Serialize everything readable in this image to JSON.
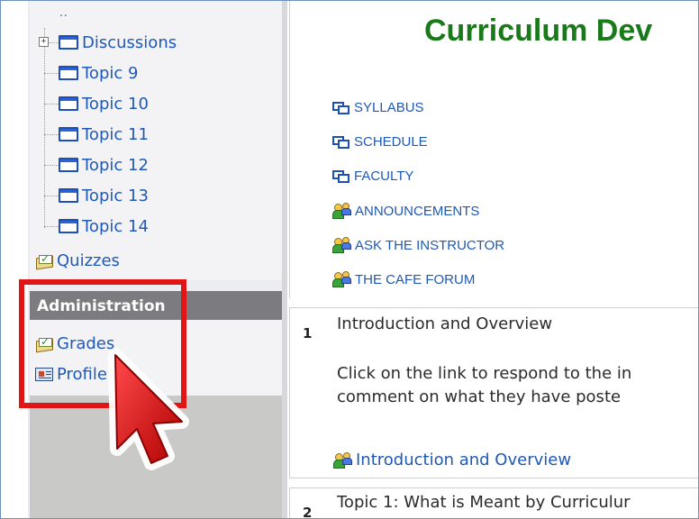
{
  "sidebar": {
    "parent_link": "..",
    "tree_items": [
      {
        "label": "Discussions",
        "expandable": true
      },
      {
        "label": "Topic 9"
      },
      {
        "label": "Topic 10"
      },
      {
        "label": "Topic 11"
      },
      {
        "label": "Topic 12"
      },
      {
        "label": "Topic 13"
      },
      {
        "label": "Topic 14"
      }
    ],
    "quizzes_label": "Quizzes",
    "administration": {
      "title": "Administration",
      "grades_label": "Grades",
      "profile_label": "Profile"
    }
  },
  "main": {
    "title": "Curriculum Dev",
    "resources": [
      {
        "label": "SYLLABUS",
        "icon": "window-icon"
      },
      {
        "label": "SCHEDULE",
        "icon": "window-icon"
      },
      {
        "label": "FACULTY",
        "icon": "window-icon"
      },
      {
        "label": "ANNOUNCEMENTS",
        "icon": "forum-icon"
      },
      {
        "label": "ASK THE INSTRUCTOR",
        "icon": "forum-icon"
      },
      {
        "label": "THE CAFE FORUM",
        "icon": "forum-icon"
      }
    ],
    "sections": [
      {
        "number": "1",
        "title": "Introduction and Overview",
        "body_line1": "Click on the link to respond to the in",
        "body_line2": "comment on what they have poste",
        "link": "Introduction and Overview"
      },
      {
        "number": "2",
        "title": "Topic 1: What is Meant by Curriculur"
      }
    ]
  },
  "colors": {
    "link": "#1f59b5",
    "title_green": "#1a7a1a",
    "highlight_red": "#e01515",
    "admin_header": "#7b7b80"
  }
}
